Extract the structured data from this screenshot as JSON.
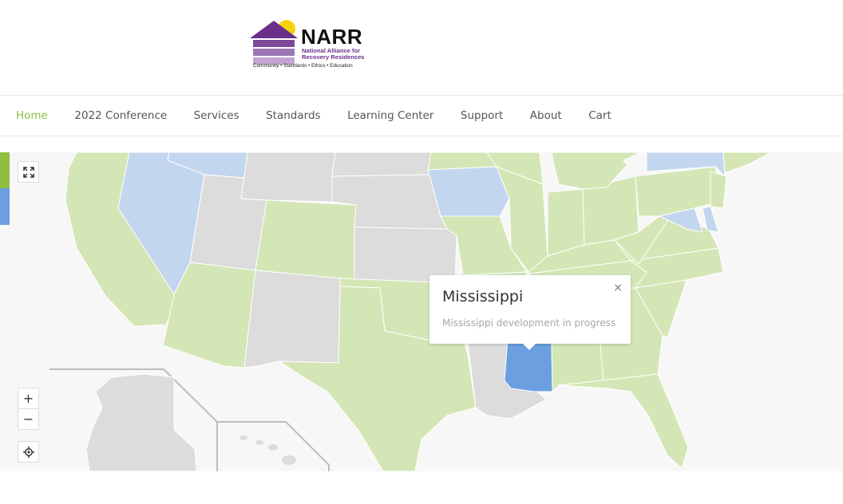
{
  "logo": {
    "title": "NARR",
    "subtitle": "National Alliance for Recovery Residences",
    "tagline": "Community • Standards • Ethics • Education"
  },
  "nav": {
    "items": [
      {
        "label": "Home",
        "active": true
      },
      {
        "label": "2022 Conference",
        "active": false
      },
      {
        "label": "Services",
        "active": false
      },
      {
        "label": "Standards",
        "active": false
      },
      {
        "label": "Learning Center",
        "active": false
      },
      {
        "label": "Support",
        "active": false
      },
      {
        "label": "About",
        "active": false
      },
      {
        "label": "Cart",
        "active": false
      }
    ]
  },
  "map": {
    "controls": {
      "fullscreen_icon": "expand-icon",
      "zoom_in": "+",
      "zoom_out": "−",
      "center_icon": "crosshair-icon"
    },
    "tooltip": {
      "title": "Mississippi",
      "text": "Mississippi development in progress",
      "close": "×"
    },
    "colors": {
      "affiliate_green": "#d4e6b5",
      "developing_blue": "#c3d6ef",
      "selected_blue": "#6b9fe0",
      "none_gray": "#dcdcdc",
      "accent_green": "#8fbf3f"
    }
  }
}
